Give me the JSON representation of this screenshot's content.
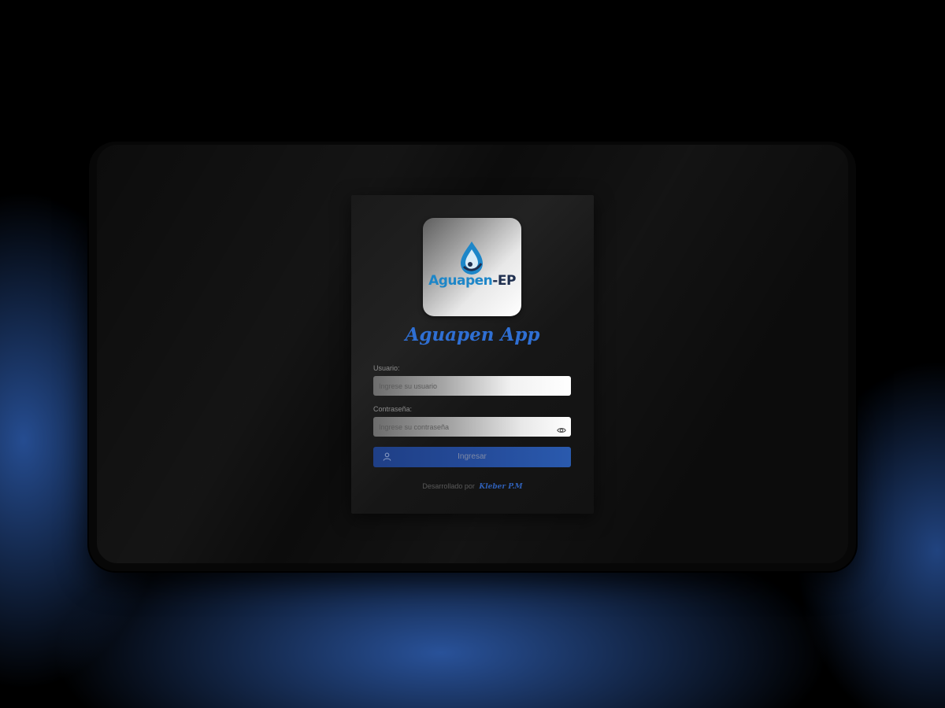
{
  "app": {
    "title": "Aguapen App"
  },
  "logo": {
    "brand_part1": "Aguapen",
    "brand_part2": "-EP",
    "icon": "water-drop-icon"
  },
  "form": {
    "username_label": "Usuario:",
    "username_placeholder": "Ingrese su usuario",
    "username_value": "",
    "password_label": "Contraseña:",
    "password_placeholder": "Ingrese su contraseña",
    "password_value": "",
    "show_password_icon": "eye-icon",
    "submit_label": "Ingresar",
    "submit_icon": "user-icon"
  },
  "footer": {
    "developed_by": "Desarrollado por",
    "author": "Kleber P.M"
  },
  "colors": {
    "accent": "#2f6fd3",
    "button": "#244a98",
    "brand_blue": "#1d86c8",
    "brand_dark": "#1f2f4f",
    "background": "#000000"
  }
}
